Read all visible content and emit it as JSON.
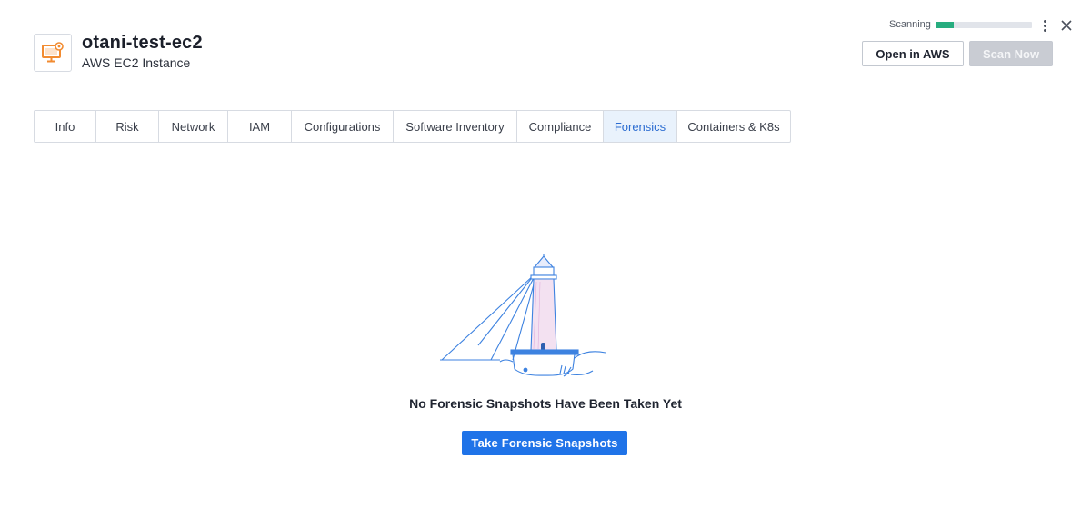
{
  "header": {
    "title": "otani-test-ec2",
    "subtitle": "AWS EC2 Instance",
    "icon": "ec2-instance-icon",
    "accent": "#f28b30"
  },
  "scan": {
    "label": "Scanning",
    "progress": 0.19,
    "color": "#27ad7f"
  },
  "actions": {
    "open_aws": "Open in AWS",
    "scan_now": "Scan Now"
  },
  "tabs": [
    {
      "label": "Info"
    },
    {
      "label": "Risk"
    },
    {
      "label": "Network"
    },
    {
      "label": "IAM"
    },
    {
      "label": "Configurations"
    },
    {
      "label": "Software Inventory"
    },
    {
      "label": "Compliance"
    },
    {
      "label": "Forensics",
      "active": true
    },
    {
      "label": "Containers & K8s"
    }
  ],
  "empty_state": {
    "illustration": "lighthouse",
    "message": "No Forensic Snapshots Have Been Taken Yet",
    "button": "Take Forensic Snapshots",
    "accent": "#1f73e8"
  }
}
